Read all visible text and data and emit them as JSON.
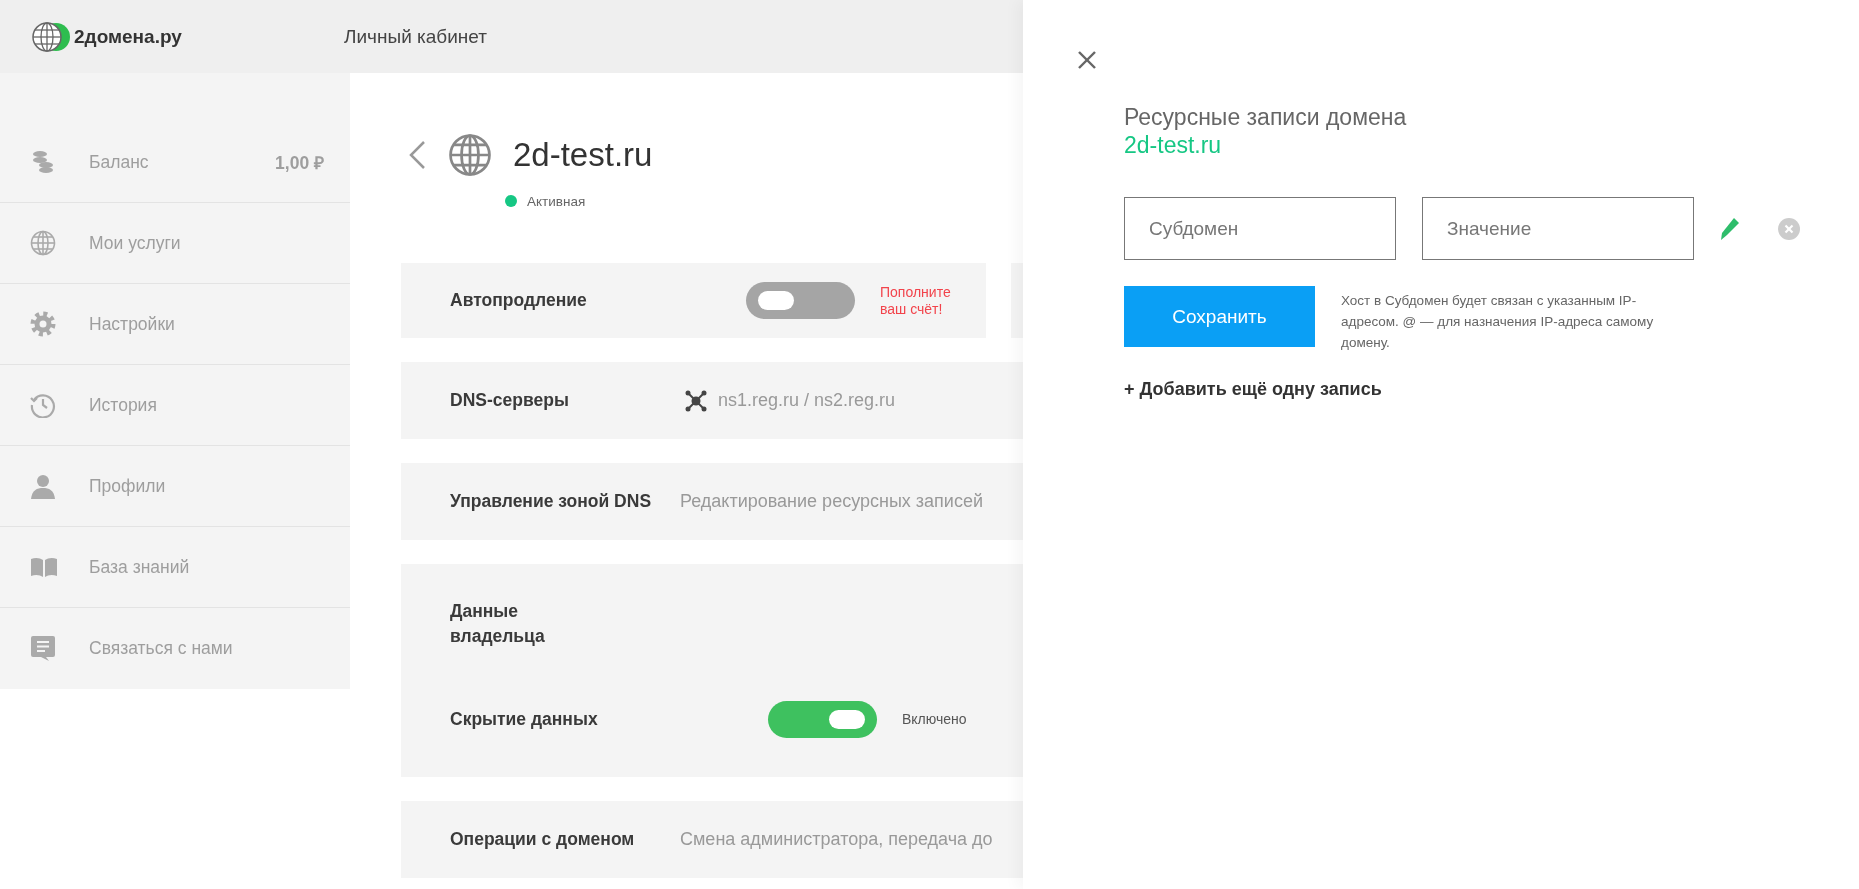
{
  "header": {
    "logo": "2домена.ру",
    "title": "Личный кабинет"
  },
  "sidebar": {
    "items": [
      {
        "label": "Баланс",
        "value": "1,00 ₽"
      },
      {
        "label": "Мои услуги"
      },
      {
        "label": "Настройки"
      },
      {
        "label": "История"
      },
      {
        "label": "Профили"
      },
      {
        "label": "База знаний"
      },
      {
        "label": "Связаться с нами"
      }
    ]
  },
  "domain": {
    "name": "2d-test.ru",
    "status": "Активная",
    "active": true
  },
  "rows": [
    {
      "kind": "toggle",
      "label": "Автопродление",
      "on": false,
      "note": "Пополните ваш счёт!"
    },
    {
      "kind": "servers",
      "label": "DNS-серверы",
      "value": "ns1.reg.ru / ns2.reg.ru"
    },
    {
      "kind": "text",
      "label": "Управление зоной DNS",
      "value": "Редактирование ресурсных записей"
    },
    {
      "kind": "group",
      "label": "Данные владельца",
      "sub": {
        "label": "Скрытие данных",
        "on": true,
        "note": "Включено"
      }
    },
    {
      "kind": "text",
      "label": "Операции с доменом",
      "value": "Смена администратора, передача до"
    }
  ],
  "panel": {
    "title": "Ресурсные записи домена",
    "domain": "2d-test.ru",
    "fields": [
      {
        "placeholder": "Субдомен"
      },
      {
        "placeholder": "Значение"
      }
    ],
    "save": "Сохранить",
    "hint": "Хост в Субдомен будет связан с указанным IP-адресом. @ — для назначения IP-адреса самому домену.",
    "add": "+ Добавить ещё одну запись"
  }
}
